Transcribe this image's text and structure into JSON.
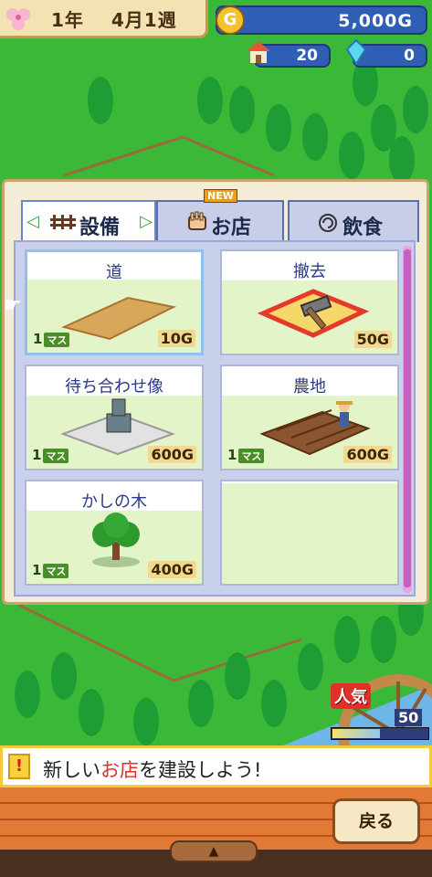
{
  "hud": {
    "date": {
      "year_label": "1年",
      "month_label": "4月",
      "week_label": "1週"
    },
    "gold": {
      "value": "5,000G",
      "icon": "gold-coin-icon",
      "icon_glyph": "G"
    },
    "population": {
      "value": "20",
      "icon": "house-icon"
    },
    "crystals": {
      "value": "0",
      "icon": "crystal-icon"
    }
  },
  "build_menu": {
    "tabs": [
      {
        "label": "設備",
        "active": true,
        "icon": "fence-icon"
      },
      {
        "label": "お店",
        "active": false,
        "badge": "NEW",
        "icon": "hand-shop-icon"
      },
      {
        "label": "飲食",
        "active": false,
        "icon": "lollipop-icon"
      }
    ],
    "items": [
      {
        "name": "道",
        "size": "1",
        "size_unit": "マス",
        "cost": "10G",
        "selected": true,
        "icon": "road-tile-icon"
      },
      {
        "name": "撤去",
        "size": "",
        "size_unit": "",
        "cost": "50G",
        "selected": false,
        "icon": "hammer-icon"
      },
      {
        "name": "待ち合わせ像",
        "size": "1",
        "size_unit": "マス",
        "cost": "600G",
        "selected": false,
        "icon": "statue-icon"
      },
      {
        "name": "農地",
        "size": "1",
        "size_unit": "マス",
        "cost": "600G",
        "selected": false,
        "icon": "farmland-icon"
      },
      {
        "name": "かしの木",
        "size": "1",
        "size_unit": "マス",
        "cost": "400G",
        "selected": false,
        "icon": "oak-tree-icon"
      }
    ]
  },
  "popularity": {
    "label": "人気",
    "value": "50",
    "fill": 0.5
  },
  "message": {
    "prefix": "新しい",
    "highlight": "お店",
    "suffix": "を建設しよう!",
    "icon": "exclamation-icon",
    "icon_glyph": "!"
  },
  "footer": {
    "back_label": "戻る",
    "expand_icon": "up-arrow-icon",
    "expand_glyph": "▲"
  },
  "colors": {
    "accent": "#e0302a",
    "panel_border": "#c9a36a",
    "hud_blue": "#2f5fb4"
  }
}
